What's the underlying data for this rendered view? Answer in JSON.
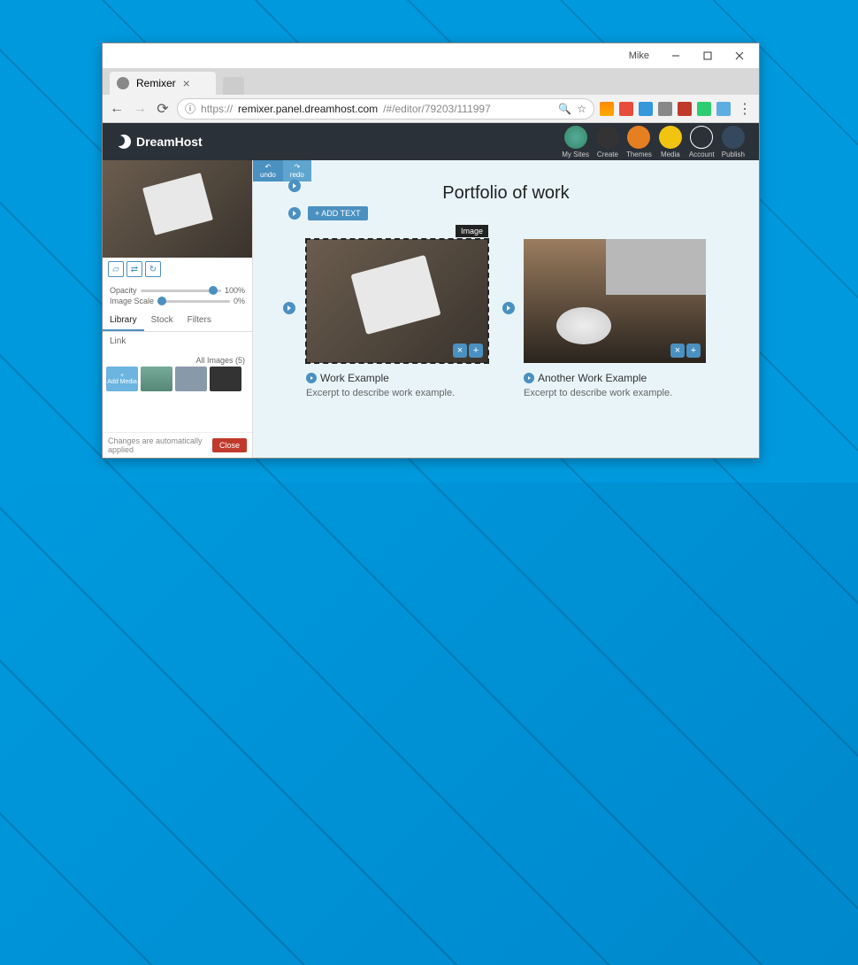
{
  "os": {
    "user": "Mike"
  },
  "browser": {
    "tab_title": "Remixer",
    "url_protocol": "https://",
    "url_host": "remixer.panel.dreamhost.com",
    "url_path": "/#/editor/79203/111997"
  },
  "topnav": {
    "brand": "DreamHost",
    "items": [
      {
        "label": "My Sites"
      },
      {
        "label": "Create"
      },
      {
        "label": "Themes"
      },
      {
        "label": "Media"
      },
      {
        "label": "Account"
      },
      {
        "label": "Publish"
      }
    ]
  },
  "sidebar": {
    "opacity_label": "Opacity",
    "opacity_value": "100%",
    "scale_label": "Image Scale",
    "scale_value": "0%",
    "tabs": [
      "Library",
      "Stock",
      "Filters",
      "Link"
    ],
    "all_images_label": "All Images (5)",
    "add_media_label": "Add Media",
    "footer_note": "Changes are automatically applied",
    "close_label": "Close"
  },
  "canvas": {
    "undo": "undo",
    "redo": "redo",
    "add_text_label": "+ ADD TEXT",
    "title": "Portfolio of work",
    "selected_badge": "Image",
    "cards": [
      {
        "title": "Work Example",
        "excerpt": "Excerpt to describe work example."
      },
      {
        "title": "Another Work Example",
        "excerpt": "Excerpt to describe work example."
      }
    ]
  }
}
